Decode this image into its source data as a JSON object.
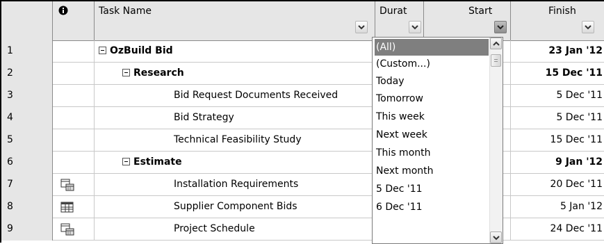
{
  "columns": {
    "id": "",
    "indicators_icon": "info-icon",
    "task_name": "Task Name",
    "duration": "Durat",
    "start": "Start",
    "finish": "Finish"
  },
  "rows": [
    {
      "id": "1",
      "indicator": "",
      "name": "OzBuild Bid",
      "finish": "23 Jan '12",
      "bold": true,
      "summary": true
    },
    {
      "id": "2",
      "indicator": "",
      "name": "Research",
      "finish": "15 Dec '11",
      "bold": true,
      "summary": true
    },
    {
      "id": "3",
      "indicator": "",
      "name": "Bid Request Documents Received",
      "finish": "5 Dec '11",
      "bold": false,
      "summary": false
    },
    {
      "id": "4",
      "indicator": "",
      "name": "Bid Strategy",
      "finish": "5 Dec '11",
      "bold": false,
      "summary": false
    },
    {
      "id": "5",
      "indicator": "",
      "name": "Technical Feasibility Study",
      "finish": "15 Dec '11",
      "bold": false,
      "summary": false
    },
    {
      "id": "6",
      "indicator": "",
      "name": "Estimate",
      "finish": "9 Jan '12",
      "bold": true,
      "summary": true
    },
    {
      "id": "7",
      "indicator": "calendar-constraint-icon",
      "name": "Installation Requirements",
      "finish": "20 Dec '11",
      "bold": false,
      "summary": false
    },
    {
      "id": "8",
      "indicator": "table-icon",
      "name": "Supplier Component Bids",
      "finish": "5 Jan '12",
      "bold": false,
      "summary": false
    },
    {
      "id": "9",
      "indicator": "calendar-constraint-icon",
      "name": "Project Schedule",
      "finish": "24 Dec '11",
      "bold": false,
      "summary": false
    }
  ],
  "filter_dropdown": {
    "column": "Start",
    "items": [
      "(All)",
      "(Custom...)",
      "Today",
      "Tomorrow",
      "This week",
      "Next week",
      "This month",
      "Next month",
      "5 Dec '11",
      "6 Dec '11"
    ],
    "selected": "(All)"
  }
}
